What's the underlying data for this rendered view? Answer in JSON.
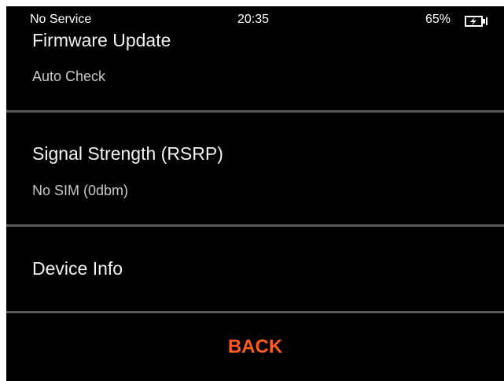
{
  "status_bar": {
    "carrier": "No Service",
    "time": "20:35",
    "battery_percent": "65%",
    "battery_icon": "battery-charging-icon"
  },
  "settings": {
    "firmware_update": {
      "title": "Firmware Update",
      "value": "Auto Check"
    },
    "signal_strength": {
      "title": "Signal Strength (RSRP)",
      "value": "No SIM (0dbm)"
    },
    "device_info": {
      "title": "Device Info"
    }
  },
  "footer": {
    "back_label": "BACK",
    "back_color": "#ff5a1f"
  },
  "colors": {
    "background": "#000000",
    "divider": "#5a5a5a",
    "text_primary": "#f2f2f2",
    "text_secondary": "#c8c8c8"
  }
}
